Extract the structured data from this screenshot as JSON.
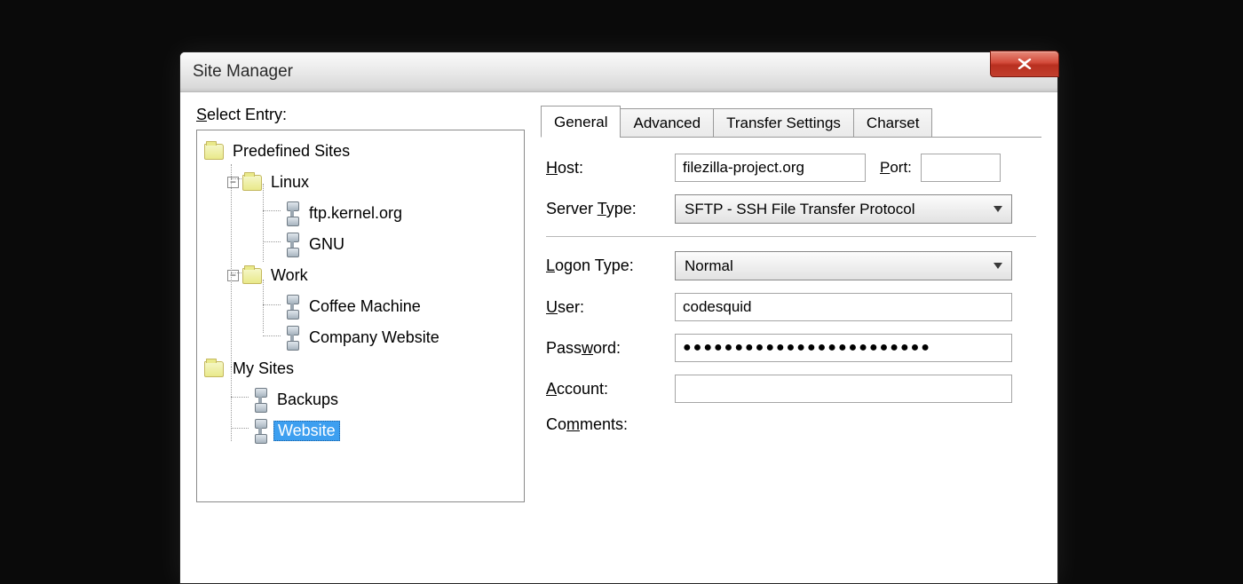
{
  "window": {
    "title": "Site Manager"
  },
  "leftPane": {
    "selectLabel": "Select Entry:",
    "tree": {
      "predefined": {
        "label": "Predefined Sites",
        "linux": {
          "label": "Linux",
          "children": [
            "ftp.kernel.org",
            "GNU"
          ]
        },
        "work": {
          "label": "Work",
          "children": [
            "Coffee Machine",
            "Company Website"
          ]
        }
      },
      "mysites": {
        "label": "My Sites",
        "children": [
          "Backups",
          "Website"
        ]
      }
    }
  },
  "tabs": [
    "General",
    "Advanced",
    "Transfer Settings",
    "Charset"
  ],
  "form": {
    "hostLabel": "Host:",
    "hostValue": "filezilla-project.org",
    "portLabel": "Port:",
    "portValue": "",
    "serverTypeLabel": "Server Type:",
    "serverTypeValue": "SFTP - SSH File Transfer Protocol",
    "logonTypeLabel": "Logon Type:",
    "logonTypeValue": "Normal",
    "userLabel": "User:",
    "userValue": "codesquid",
    "passwordLabel": "Password:",
    "passwordValue": "●●●●●●●●●●●●●●●●●●●●●●●●",
    "accountLabel": "Account:",
    "accountValue": "",
    "commentsLabel": "Comments:"
  }
}
